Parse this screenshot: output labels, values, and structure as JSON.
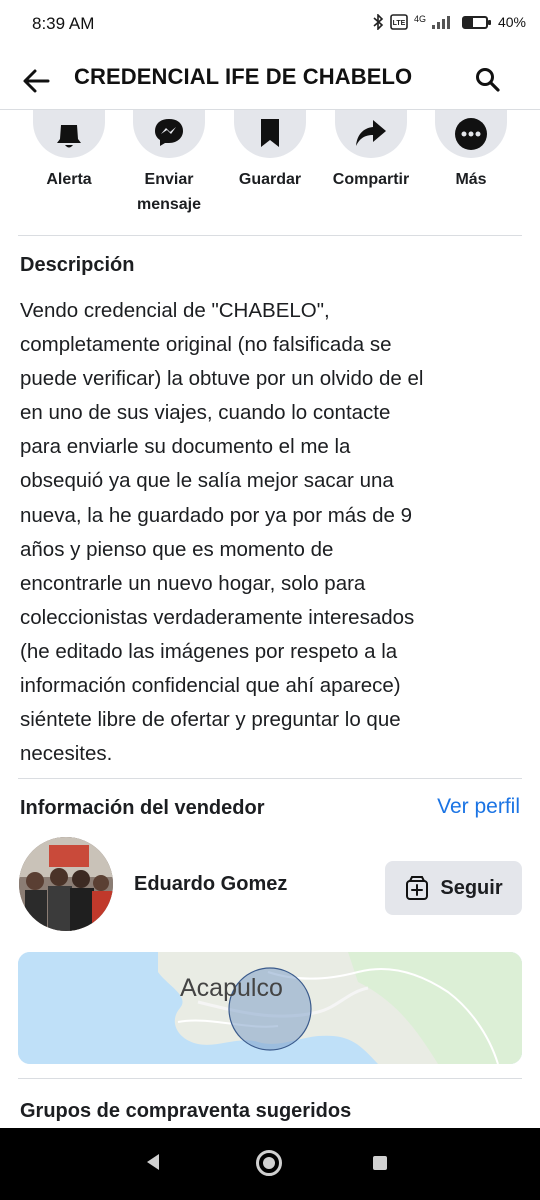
{
  "status_bar": {
    "time": "8:39 AM",
    "network": "4G",
    "battery": "40%",
    "battery_level": 0.4
  },
  "header": {
    "title": "CREDENCIAL IFE DE CHABELO",
    "back_icon": "arrow-left-icon",
    "search_icon": "search-icon"
  },
  "actions": [
    {
      "label": "Alerta",
      "icon": "bell-icon"
    },
    {
      "label": "Enviar\nmensaje",
      "icon": "messenger-icon"
    },
    {
      "label": "Guardar",
      "icon": "bookmark-icon"
    },
    {
      "label": "Compartir",
      "icon": "share-icon"
    },
    {
      "label": "Más",
      "icon": "more-icon"
    }
  ],
  "description": {
    "heading": "Descripción",
    "lines": [
      "Vendo credencial de \"CHABELO\",",
      "completamente original (no falsificada se",
      "puede verificar) la obtuve por un olvido de el",
      "en uno de sus viajes, cuando lo contacte",
      "para enviarle su documento el me la",
      "obsequió ya que le salía mejor sacar una",
      "nueva, la he guardado por ya por más de 9",
      "años y pienso que es momento de",
      "encontrarle un nuevo hogar, solo para",
      "coleccionistas verdaderamente interesados",
      "(he editado las imágenes por respeto a la",
      "información confidencial que ahí aparece)",
      "siéntete libre de ofertar y preguntar lo que",
      "necesites."
    ]
  },
  "seller": {
    "heading": "Información del vendedor",
    "view_profile": "Ver perfil",
    "name": "Eduardo Gomez",
    "follow_label": "Seguir",
    "follow_icon": "follow-icon"
  },
  "map": {
    "city": "Acapulco"
  },
  "groups": {
    "heading": "Grupos de compraventa sugeridos"
  },
  "colors": {
    "accent": "#1b74e4",
    "button_bg": "#e4e6eb",
    "divider": "#dadde1",
    "text": "#1c1e21",
    "map_water": "#bfe0f8"
  }
}
